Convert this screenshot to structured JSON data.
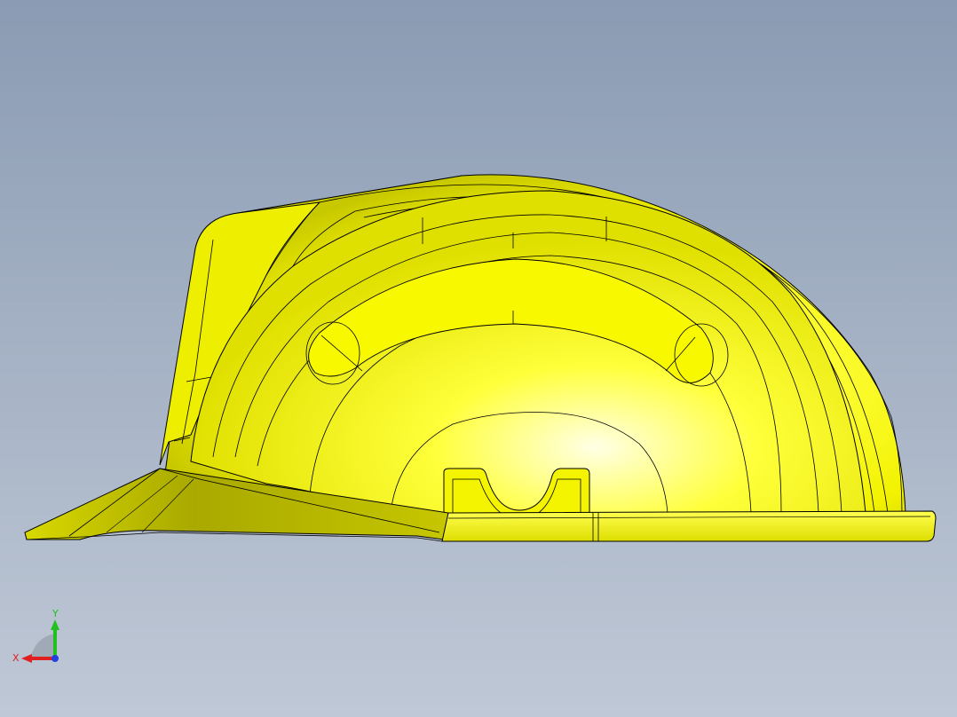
{
  "viewport": {
    "background_top": "#8a9bb3",
    "background_bottom": "#bfc8d6"
  },
  "model": {
    "name": "hard-hat-side-view",
    "color": "#ffff00",
    "shade_color": "#b8b800",
    "edge_color": "#000000"
  },
  "triad": {
    "x_label": "X",
    "y_label": "Y",
    "x_color": "#e02020",
    "y_color": "#20c020",
    "z_color": "#2040e0"
  }
}
